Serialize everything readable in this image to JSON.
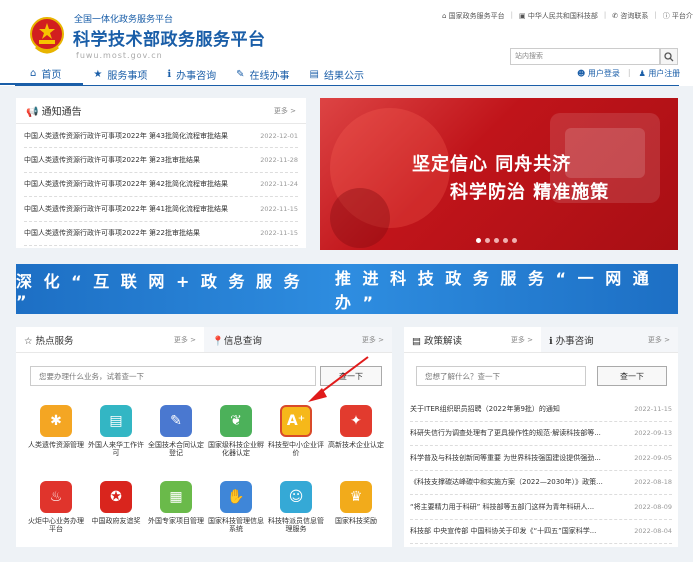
{
  "header": {
    "sup_title": "全国一体化政务服务平台",
    "title": "科学技术部政务服务平台",
    "domain": "fuwu.most.gov.cn",
    "links": [
      "国家政务服务平台",
      "中华人民共和国科技部",
      "咨询联系",
      "平台介绍"
    ],
    "search_placeholder": "站内搜索",
    "login": "用户登录",
    "register": "用户注册"
  },
  "nav": [
    "首页",
    "服务事项",
    "办事咨询",
    "在线办事",
    "结果公示"
  ],
  "notice": {
    "title": "通知通告",
    "more": "更多 >",
    "items": [
      {
        "text": "中国人类遗传资源行政许可事项2022年 第43批简化流程审批结果",
        "date": "2022-12-01"
      },
      {
        "text": "中国人类遗传资源行政许可事项2022年 第23批审批结果",
        "date": "2022-11-28"
      },
      {
        "text": "中国人类遗传资源行政许可事项2022年 第42批简化流程审批结果",
        "date": "2022-11-24"
      },
      {
        "text": "中国人类遗传资源行政许可事项2022年 第41批简化流程审批结果",
        "date": "2022-11-15"
      },
      {
        "text": "中国人类遗传资源行政许可事项2022年 第22批审批结果",
        "date": "2022-11-15"
      }
    ]
  },
  "banner": {
    "line1": "坚定信心 同舟共济",
    "line2": "科学防治 精准施策"
  },
  "ribbon": {
    "left": "深 化 “ 互 联 网 + 政 务 服 务 ”",
    "right": "推 进 科 技 政 务 服 务 “ 一 网 通 办 ”"
  },
  "hot": {
    "tab1": "热点服务",
    "tab2": "信息查询",
    "more": "更多 >",
    "placeholder": "您要办理什么业务，试着查一下",
    "button": "查一下",
    "services": [
      {
        "label": "人类遗传资源管理",
        "color": "#f4a623",
        "icon": "dna-icon",
        "glyph": "✱"
      },
      {
        "label": "外国人来华工作许可",
        "color": "#33b6c4",
        "icon": "id-card-icon",
        "glyph": "▤"
      },
      {
        "label": "全国技术合同认定登记",
        "color": "#4a78d0",
        "icon": "contract-icon",
        "glyph": "✎"
      },
      {
        "label": "国家级科技企业孵化器认定",
        "color": "#4cb15a",
        "icon": "sprout-icon",
        "glyph": "❦"
      },
      {
        "label": "科技型中小企业评价",
        "color": "#f6b81a",
        "icon": "rating-icon",
        "glyph": "A⁺"
      },
      {
        "label": "高新技术企业认定",
        "color": "#e23b2e",
        "icon": "leaf-icon",
        "glyph": "✦"
      },
      {
        "label": "火炬中心业务办理平台",
        "color": "#e0342c",
        "icon": "torch-icon",
        "glyph": "♨"
      },
      {
        "label": "中国政府友谊奖",
        "color": "#d9251d",
        "icon": "medal-icon",
        "glyph": "✪"
      },
      {
        "label": "外国专家项目管理",
        "color": "#6aba4a",
        "icon": "document-icon",
        "glyph": "▦"
      },
      {
        "label": "国家科技管理信息系统",
        "color": "#3f86d8",
        "icon": "handshake-icon",
        "glyph": "✋"
      },
      {
        "label": "科技特派员信息管理服务",
        "color": "#35a9d6",
        "icon": "person-icon",
        "glyph": "☺"
      },
      {
        "label": "国家科技奖励",
        "color": "#f2ab1b",
        "icon": "trophy-icon",
        "glyph": "♛"
      }
    ]
  },
  "policy": {
    "tab1": "政策解读",
    "tab2": "办事咨询",
    "more": "更多 >",
    "placeholder": "您想了解什么？查一下",
    "button": "查一下",
    "items": [
      {
        "text": "关于ITER组织职员招聘（2022年第9批）的通知",
        "date": "2022-11-15"
      },
      {
        "text": "科研失信行为调查处理有了更具操作性的规范·解读科技部等...",
        "date": "2022-09-13"
      },
      {
        "text": "科学普及与科技创新同等重要 为世界科技强国建设提供强劲...",
        "date": "2022-09-05"
      },
      {
        "text": "《科技支撑碳达峰碳中和实施方案（2022—2030年）》政策...",
        "date": "2022-08-18"
      },
      {
        "text": "“将主要精力用于科研” 科技部等五部门这样为青年科研人...",
        "date": "2022-08-09"
      },
      {
        "text": "科技部 中央宣传部 中国科协关于印发《“十四五”国家科学...",
        "date": "2022-08-04"
      }
    ]
  }
}
